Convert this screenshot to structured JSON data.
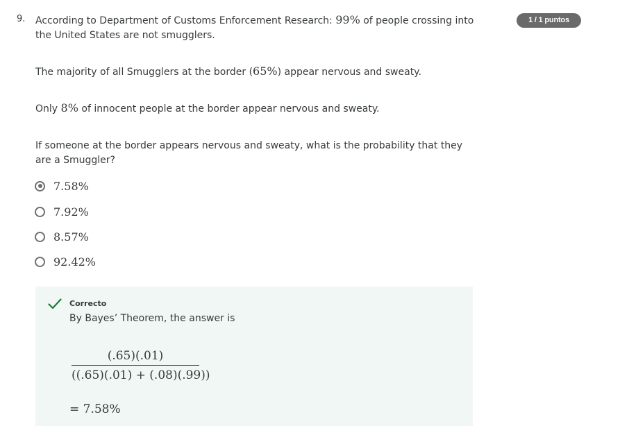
{
  "question": {
    "number": "9.",
    "points_badge": "1 / 1 puntos",
    "p1_before": "According to Department of Customs Enforcement Research: ",
    "p1_math": "99%",
    "p1_after": " of people crossing into the United States are not smugglers.",
    "p2_before": "The majority of all Smugglers at the border (",
    "p2_math": "65%",
    "p2_after": ") appear nervous and sweaty.",
    "p3_before": "Only ",
    "p3_math": "8%",
    "p3_after": " of innocent people at the border appear nervous and sweaty.",
    "p4": "If someone at the border appears nervous and sweaty, what is the probability that they are a Smuggler?"
  },
  "options": [
    {
      "label": "7.58%",
      "selected": true
    },
    {
      "label": "7.92%",
      "selected": false
    },
    {
      "label": "8.57%",
      "selected": false
    },
    {
      "label": "92.42%",
      "selected": false
    }
  ],
  "feedback": {
    "status": "Correcto",
    "text": "By Bayes’ Theorem, the answer is",
    "fraction_numerator": "(.65)(.01)",
    "fraction_denominator": "((.65)(.01) + (.08)(.99))",
    "result": "= 7.58%",
    "icon": "checkmark-icon"
  },
  "colors": {
    "badge_bg": "#6a6a6a",
    "feedback_bg": "#f1f7f4",
    "check_green": "#1a7a3c",
    "text": "#373a3c",
    "radio": "#6f6f6f"
  }
}
